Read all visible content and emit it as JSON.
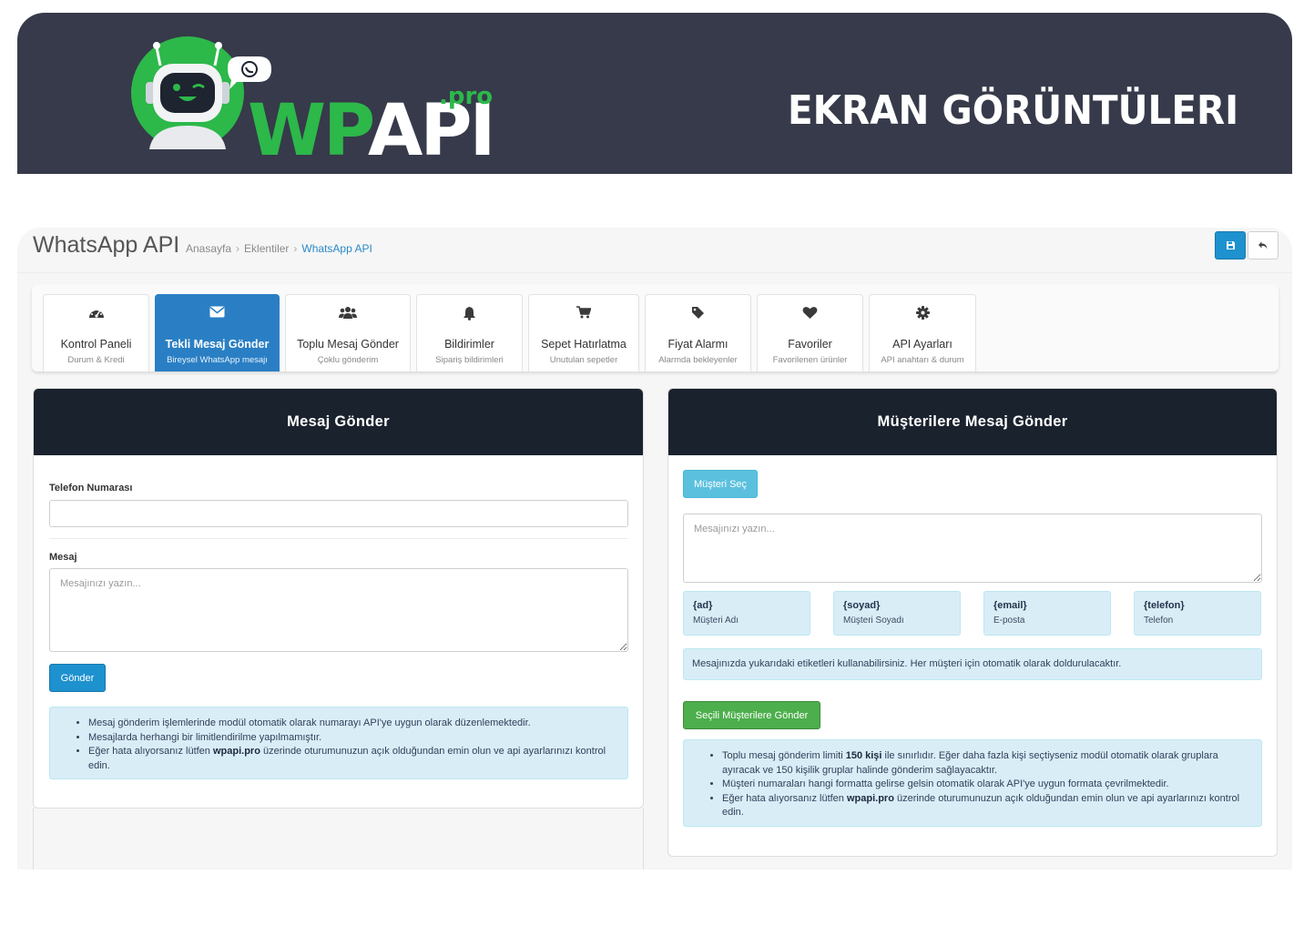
{
  "banner": {
    "logo_text": "WPAPI",
    "logo_suffix": ".pro",
    "title": "EKRAN GÖRÜNTÜLERI",
    "colors": {
      "background": "#363a4a",
      "green": "#2db84a",
      "white": "#ffffff"
    }
  },
  "header": {
    "title": "WhatsApp API",
    "breadcrumb": [
      {
        "label": "Anasayfa"
      },
      {
        "label": "Eklentiler"
      },
      {
        "label": "WhatsApp API"
      }
    ],
    "save_icon": "save-icon",
    "back_icon": "reply-icon"
  },
  "tabs": [
    {
      "label": "Kontrol Paneli",
      "sub": "Durum & Kredi",
      "icon": "dashboard-icon",
      "active": false
    },
    {
      "label": "Tekli Mesaj Gönder",
      "sub": "Bireysel WhatsApp mesajı",
      "icon": "envelope-icon",
      "active": true
    },
    {
      "label": "Toplu Mesaj Gönder",
      "sub": "Çoklu gönderim",
      "icon": "users-icon",
      "active": false
    },
    {
      "label": "Bildirimler",
      "sub": "Sipariş bildirimleri",
      "icon": "bell-icon",
      "active": false
    },
    {
      "label": "Sepet Hatırlatma",
      "sub": "Unutulan sepetler",
      "icon": "cart-icon",
      "active": false
    },
    {
      "label": "Fiyat Alarmı",
      "sub": "Alarmda bekleyenler",
      "icon": "tag-icon",
      "active": false
    },
    {
      "label": "Favoriler",
      "sub": "Favorilenen ürünler",
      "icon": "heart-icon",
      "active": false
    },
    {
      "label": "API Ayarları",
      "sub": "API anahtarı & durum",
      "icon": "gear-icon",
      "active": false
    }
  ],
  "left_panel": {
    "title": "Mesaj Gönder",
    "phone_label": "Telefon Numarası",
    "phone_value": "",
    "message_label": "Mesaj",
    "message_placeholder": "Mesajınızı yazın...",
    "send_button": "Gönder",
    "info": [
      "Mesaj gönderim işlemlerinde modül otomatik olarak numarayı API'ye uygun olarak düzenlemektedir.",
      "Mesajlarda herhangi bir limitlendirilme yapılmamıştır.",
      {
        "before": "Eğer hata alıyorsanız lütfen ",
        "bold": "wpapi.pro",
        "after": " üzerinde oturumunuzun açık olduğundan emin olun ve api ayarlarınızı kontrol edin."
      }
    ]
  },
  "right_panel": {
    "title": "Müşterilere Mesaj Gönder",
    "select_button": "Müşteri Seç",
    "message_placeholder": "Mesajınızı yazın...",
    "tags": [
      {
        "key": "{ad}",
        "desc": "Müşteri Adı"
      },
      {
        "key": "{soyad}",
        "desc": "Müşteri Soyadı"
      },
      {
        "key": "{email}",
        "desc": "E-posta"
      },
      {
        "key": "{telefon}",
        "desc": "Telefon"
      }
    ],
    "tags_note": "Mesajınızda yukarıdaki etiketleri kullanabilirsiniz. Her müşteri için otomatik olarak doldurulacaktır.",
    "send_button": "Seçili Müşterilere Gönder",
    "info": [
      {
        "before": "Toplu mesaj gönderim limiti ",
        "bold": "150 kişi",
        "after": " ile sınırlıdır. Eğer daha fazla kişi seçtiyseniz modül otomatik olarak gruplara ayıracak ve 150 kişilik gruplar halinde gönderim sağlayacaktır."
      },
      {
        "before": "Müşteri numaraları hangi formatta gelirse gelsin otomatik olarak API'ye uygun formata çevrilmektedir.",
        "bold": "",
        "after": ""
      },
      {
        "before": "Eğer hata alıyorsanız lütfen ",
        "bold": "wpapi.pro",
        "after": " üzerinde oturumunuzun açık olduğundan emin olun ve api ayarlarınızı kontrol edin."
      }
    ]
  }
}
